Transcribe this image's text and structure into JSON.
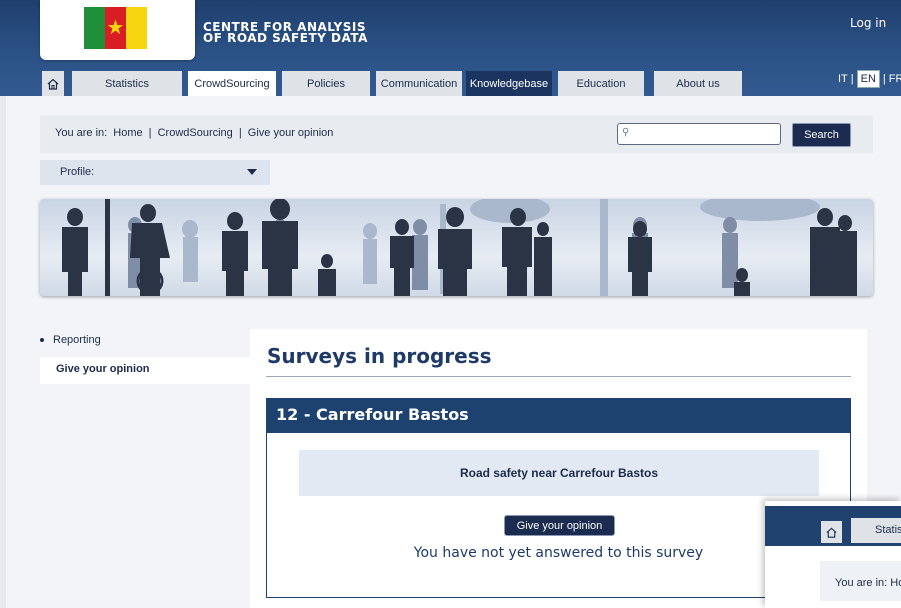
{
  "header": {
    "title_line1": "CENTRE FOR ANALYSIS",
    "title_line2": "OF ROAD SAFETY DATA",
    "login": "Log in",
    "brand_color": "#2b5286"
  },
  "nav": {
    "home_icon": "home-icon",
    "tabs": [
      {
        "label": "Statistics"
      },
      {
        "label": "CrowdSourcing"
      },
      {
        "label": "Policies"
      },
      {
        "label": "Communication"
      },
      {
        "label": "Knowledgebase"
      },
      {
        "label": "Education"
      },
      {
        "label": "About us"
      }
    ]
  },
  "languages": {
    "it": "IT",
    "en": "EN",
    "fr": "FR"
  },
  "breadcrumb": {
    "prefix": "You are in:",
    "items": [
      "Home",
      "CrowdSourcing",
      "Give your opinion"
    ],
    "separator": "|"
  },
  "search": {
    "placeholder": "",
    "button": "Search"
  },
  "profile": {
    "label": "Profile:"
  },
  "sidebar": {
    "items": [
      {
        "label": "Reporting"
      },
      {
        "label": "Give your opinion"
      }
    ]
  },
  "main": {
    "title": "Surveys in progress",
    "survey": {
      "heading": "12 - Carrefour Bastos",
      "description": "Road safety near Carrefour Bastos",
      "button": "Give your opinion",
      "status": "You have not yet answered to this survey"
    }
  },
  "overlay": {
    "tab": "Statistics",
    "crumb": "You are in: Home"
  }
}
